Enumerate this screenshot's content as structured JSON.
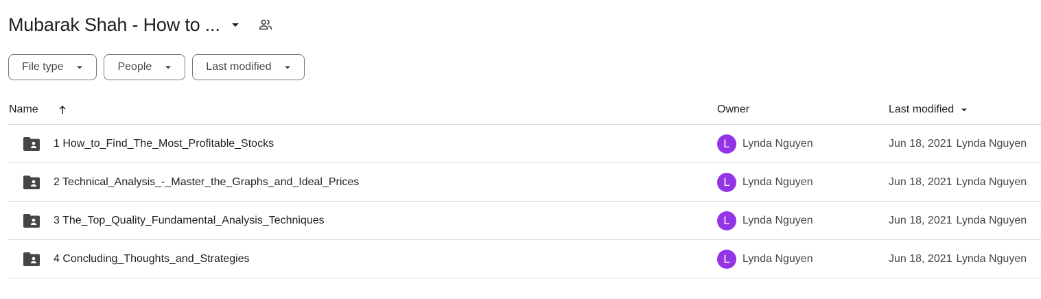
{
  "header": {
    "title": "Mubarak Shah - How to ...",
    "title_menu_icon": "arrow-drop-down-icon",
    "shared_icon": "people-outline-icon"
  },
  "filters": [
    {
      "label": "File type"
    },
    {
      "label": "People"
    },
    {
      "label": "Last modified"
    }
  ],
  "table": {
    "columns": {
      "name": "Name",
      "owner": "Owner",
      "last_modified": "Last modified"
    },
    "sort": {
      "column": "name",
      "direction": "ascending",
      "icon": "arrow-up-icon"
    },
    "rows": [
      {
        "name": "1 How_to_Find_The_Most_Profitable_Stocks",
        "icon": "shared-folder-icon",
        "owner_initial": "L",
        "owner": "Lynda Nguyen",
        "modified_date": "Jun 18, 2021",
        "modified_by": "Lynda Nguyen"
      },
      {
        "name": "2 Technical_Analysis_-_Master_the_Graphs_and_Ideal_Prices",
        "icon": "shared-folder-icon",
        "owner_initial": "L",
        "owner": "Lynda Nguyen",
        "modified_date": "Jun 18, 2021",
        "modified_by": "Lynda Nguyen"
      },
      {
        "name": "3 The_Top_Quality_Fundamental_Analysis_Techniques",
        "icon": "shared-folder-icon",
        "owner_initial": "L",
        "owner": "Lynda Nguyen",
        "modified_date": "Jun 18, 2021",
        "modified_by": "Lynda Nguyen"
      },
      {
        "name": "4 Concluding_Thoughts_and_Strategies",
        "icon": "shared-folder-icon",
        "owner_initial": "L",
        "owner": "Lynda Nguyen",
        "modified_date": "Jun 18, 2021",
        "modified_by": "Lynda Nguyen"
      }
    ]
  },
  "colors": {
    "avatar": "#9334e6",
    "icon": "#444746",
    "border": "#dadce0",
    "chip_border": "#747775"
  }
}
